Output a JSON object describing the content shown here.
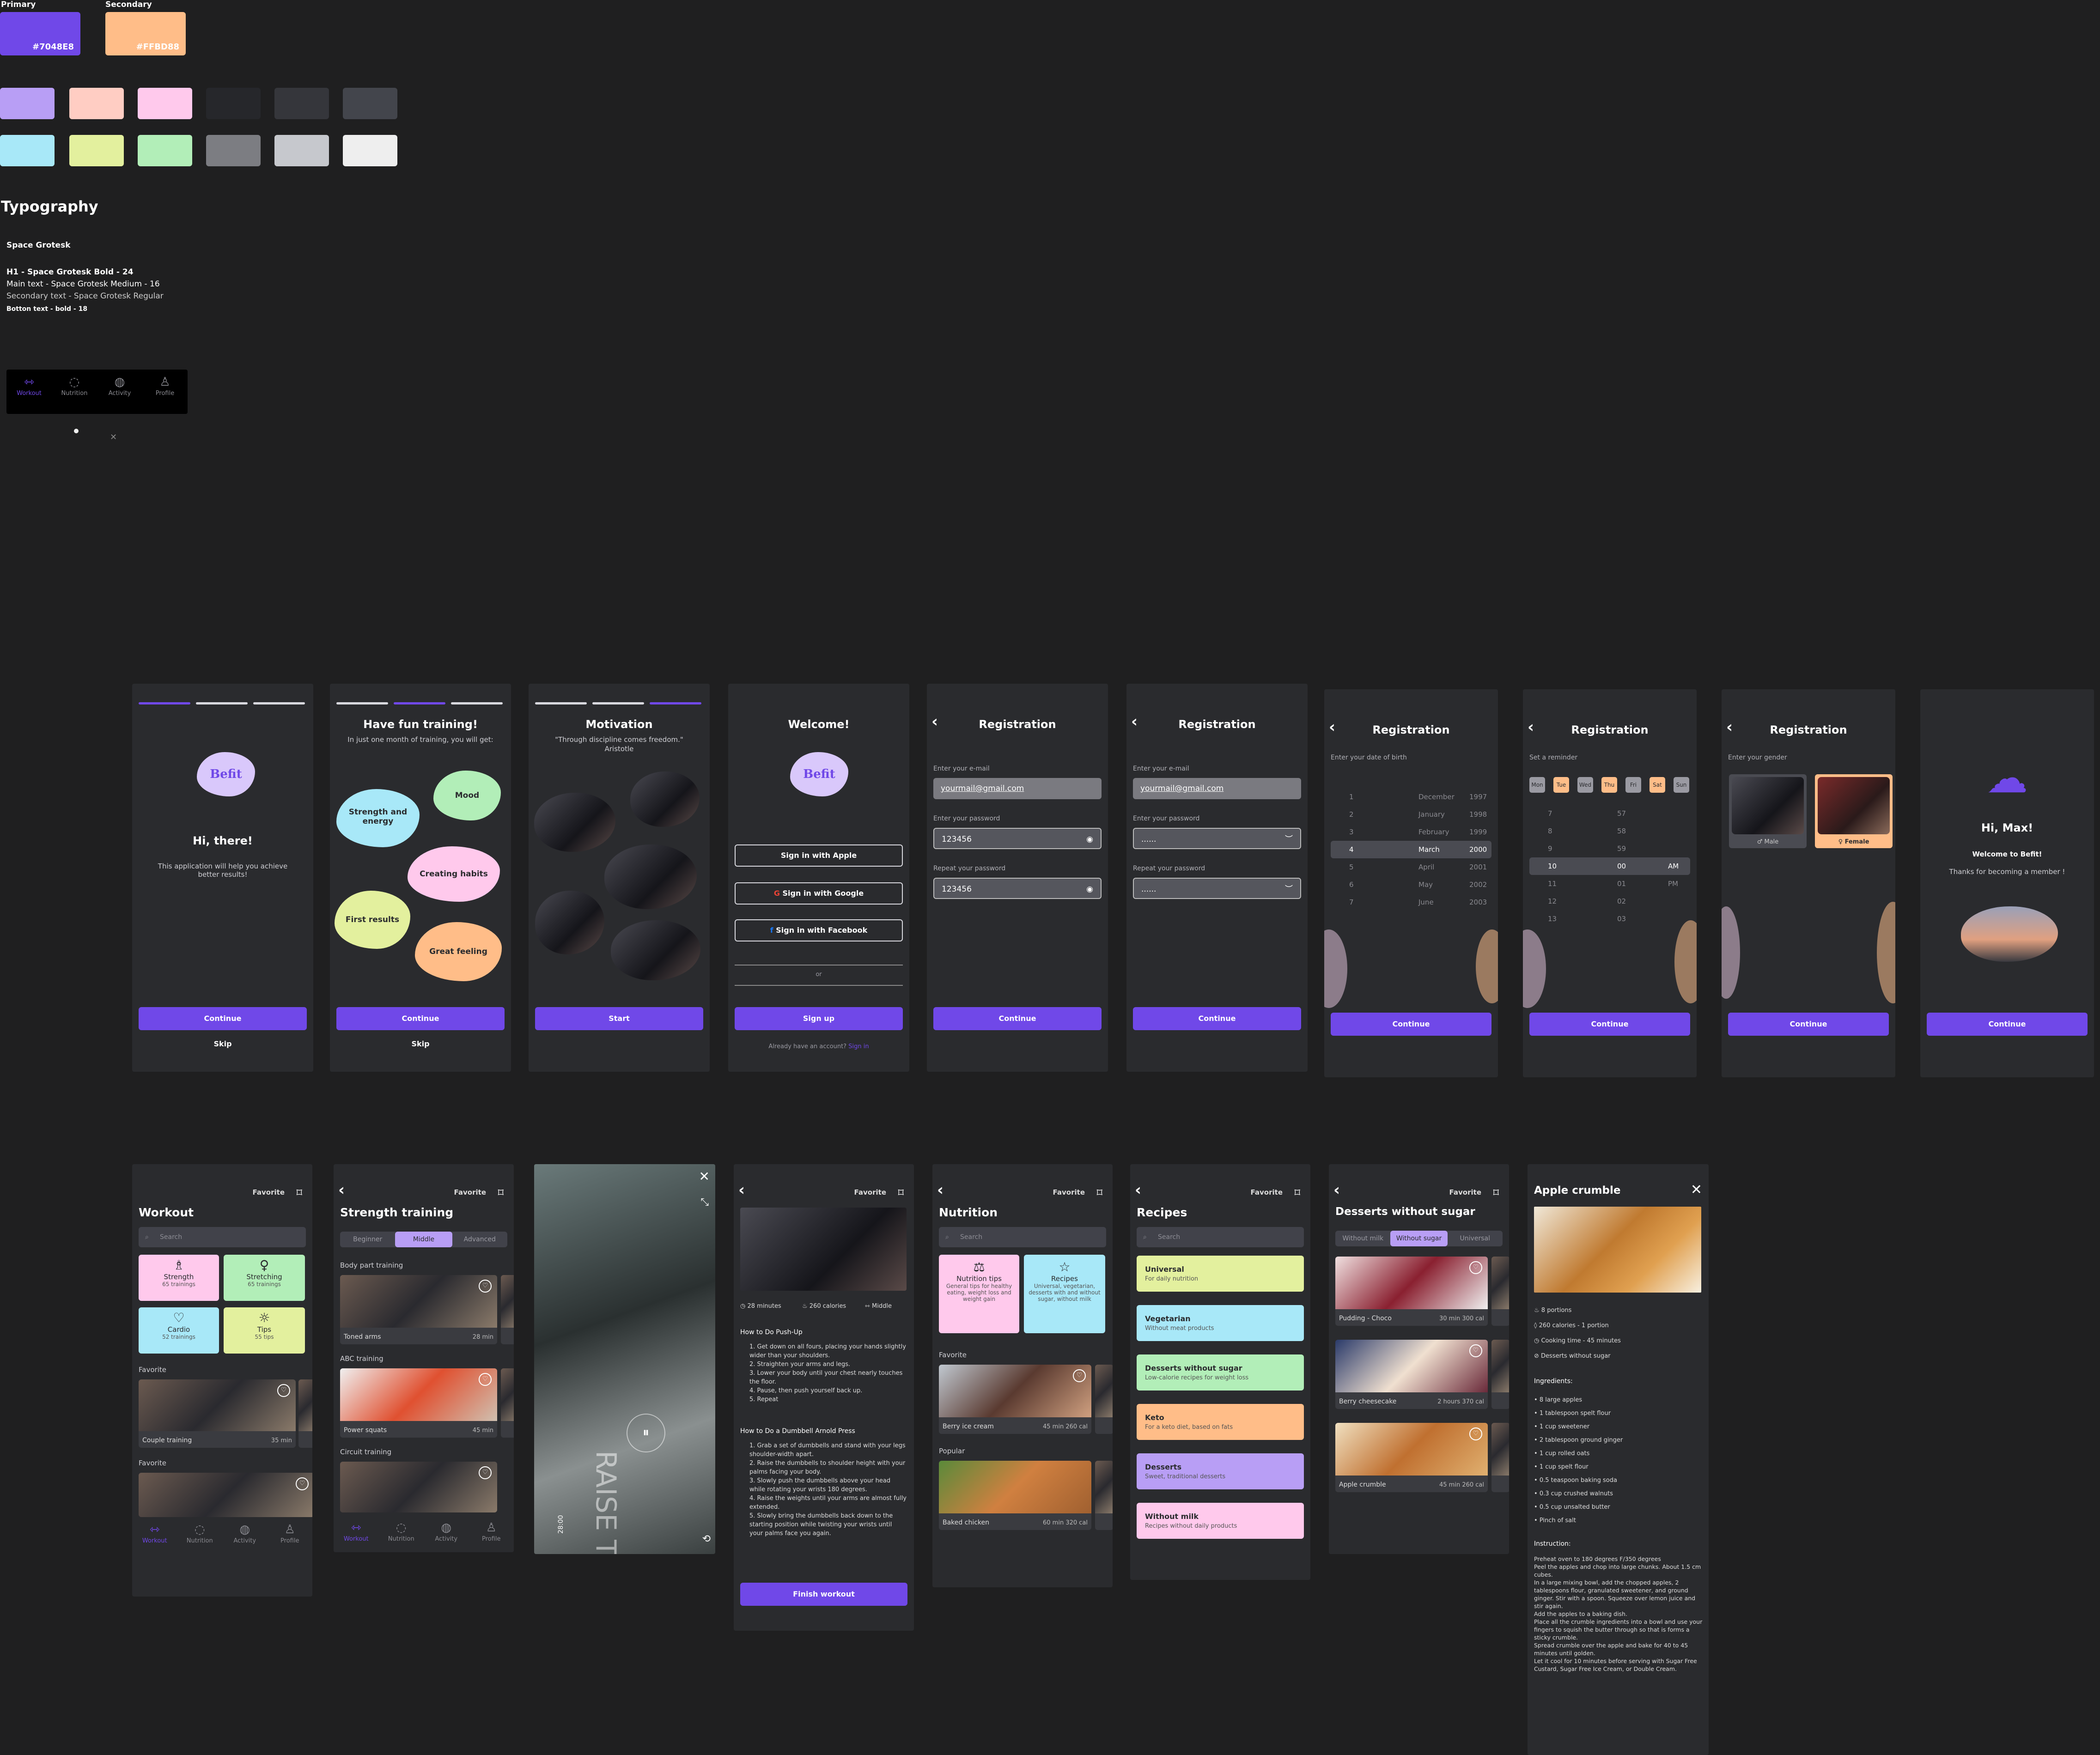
{
  "palette": {
    "primary_label": "Primary",
    "primary_hex": "#7048E8",
    "primary": "#7048e8",
    "secondary_label": "Secondary",
    "secondary_hex": "#FFBD88",
    "secondary": "#ffbd88",
    "row1": [
      "#b89ef5",
      "#ffcdc3",
      "#ffc9ec",
      "#26272b",
      "#35363b",
      "#43454c"
    ],
    "row2": [
      "#a8e8f8",
      "#e3f09e",
      "#b2eeb8",
      "#7c7d82",
      "#c6c8cd",
      "#eeeeee"
    ]
  },
  "typography": {
    "heading": "Typography",
    "font": "Space Grotesk",
    "h1": "H1 - Space Grotesk Bold - 24",
    "main": "Main text - Space Grotesk Medium - 16",
    "secondary": "Secondary text - Space Grotesk Regular",
    "button": "Botton text - bold - 18"
  },
  "navbar": {
    "items": [
      "Workout",
      "Nutrition",
      "Activity",
      "Profile"
    ]
  },
  "onboarding": {
    "s1": {
      "logo": "Befit",
      "title": "Hi, there!",
      "text": "This application will help you achieve better results!",
      "button": "Continue",
      "skip": "Skip"
    },
    "s2": {
      "title": "Have fun training!",
      "subtitle": "In just one month of training, you will get:",
      "blobs": [
        "Mood",
        "Strength and energy",
        "Creating habits",
        "First results",
        "Great feeling"
      ],
      "button": "Continue",
      "skip": "Skip"
    },
    "s3": {
      "title": "Motivation",
      "quote": "\"Through discipline comes freedom.\"",
      "author": "Aristotle",
      "button": "Start"
    },
    "s4": {
      "title": "Welcome!",
      "logo": "Befit",
      "apple": "Sign in with Apple",
      "google": "Sign in with Google",
      "facebook": "Sign in with Facebook",
      "or": "or",
      "signup": "Sign up",
      "have": "Already have an account?",
      "signin": "Sign in"
    }
  },
  "registration": {
    "title": "Registration",
    "email_label": "Enter your e-mail",
    "email": "yourmail@gmail.com",
    "password_label": "Enter your password",
    "password": "123456",
    "repeat_label": "Repeat your password",
    "repeat": "123456",
    "hidden": "......",
    "button": "Continue",
    "dob_label": "Enter your date of birth",
    "dob_rows": [
      [
        "1",
        "December",
        "1997"
      ],
      [
        "2",
        "January",
        "1998"
      ],
      [
        "3",
        "February",
        "1999"
      ],
      [
        "4",
        "March",
        "2000"
      ],
      [
        "5",
        "April",
        "2001"
      ],
      [
        "6",
        "May",
        "2002"
      ],
      [
        "7",
        "June",
        "2003"
      ]
    ],
    "reminder_label": "Set a reminder",
    "days": [
      "Mon",
      "Tue",
      "Wed",
      "Thu",
      "Fri",
      "Sat",
      "Sun"
    ],
    "time_rows": [
      [
        "7",
        "57",
        ""
      ],
      [
        "8",
        "58",
        ""
      ],
      [
        "9",
        "59",
        ""
      ],
      [
        "10",
        "00",
        "AM"
      ],
      [
        "11",
        "01",
        "PM"
      ],
      [
        "12",
        "02",
        ""
      ],
      [
        "13",
        "03",
        ""
      ]
    ],
    "gender_label": "Enter your gender",
    "male": "Male",
    "female": "Female",
    "done_title": "Hi, Max!",
    "done_welcome": "Welcome to Befit!",
    "done_thanks": "Thanks for becoming a member !"
  },
  "workout": {
    "title": "Workout",
    "favorite": "Favorite",
    "search": "Search",
    "tiles": [
      {
        "name": "Strength",
        "sub": "65 trainings"
      },
      {
        "name": "Stretching",
        "sub": "65 trainings"
      },
      {
        "name": "Cardio",
        "sub": "52 trainings"
      },
      {
        "name": "Tips",
        "sub": "55 tips"
      }
    ],
    "fav_label": "Favorite",
    "fav_card": "Couple training",
    "fav_time": "35 min",
    "fav_label2": "Favorite"
  },
  "strength": {
    "title": "Strength training",
    "favorite": "Favorite",
    "tabs": [
      "Beginner",
      "Middle",
      "Advanced"
    ],
    "sections": [
      {
        "label": "Body part training",
        "card": "Toned arms",
        "time": "28 min"
      },
      {
        "label": "ABC training",
        "card": "Power squats",
        "time": "45 min"
      },
      {
        "label": "Circuit training",
        "card": "",
        "time": ""
      }
    ]
  },
  "video": {
    "time": "28:00",
    "overlay": "RAISE THE BAR"
  },
  "exercise": {
    "favorite": "Favorite",
    "minutes": "28 minutes",
    "calories": "260 calories",
    "level": "Middle",
    "h1": "How to Do Push-Up",
    "steps1": [
      "1. Get down on all fours, placing your hands slightly wider than your shoulders.",
      "2. Straighten your arms and legs.",
      "3. Lower your body until your chest nearly touches the floor.",
      "4. Pause, then push yourself back up.",
      "5. Repeat"
    ],
    "h2": "How to Do a Dumbbell Arnold Press",
    "steps2": [
      "1. Grab a set of dumbbells and stand with your legs shoulder-width apart.",
      "2. Raise the dumbbells to shoulder height with your palms facing your body.",
      "3. Slowly push the dumbbells above your head while rotating your wrists 180 degrees.",
      "4. Raise the weights until your arms are almost fully extended.",
      "5. Slowly bring the dumbbells back down to the starting position while twisting your wrists until your palms face you again."
    ],
    "button": "Finish workout"
  },
  "nutrition": {
    "title": "Nutrition",
    "favorite": "Favorite",
    "search": "Search",
    "tip_title": "Nutrition tips",
    "tip_text": "General tips for healthy eating, weight loss and weight gain",
    "rec_title": "Recipes",
    "rec_text": "Universal, vegetarian, desserts with and without sugar, without milk",
    "fav_label": "Favorite",
    "fav_card": "Berry ice cream",
    "fav_meta": "45 min   260 cal",
    "pop_label": "Popular",
    "pop_card": "Baked chicken",
    "pop_meta": "60 min   320 cal"
  },
  "recipes": {
    "title": "Recipes",
    "favorite": "Favorite",
    "search": "Search",
    "cats": [
      {
        "name": "Universal",
        "sub": "For daily nutrition",
        "color": "#e3f09e"
      },
      {
        "name": "Vegetarian",
        "sub": "Without meat products",
        "color": "#a8e8f8"
      },
      {
        "name": "Desserts without sugar",
        "sub": "Low-calorie recipes for weight loss",
        "color": "#b2eeb8"
      },
      {
        "name": "Keto",
        "sub": "For a keto diet, based on fats",
        "color": "#ffbd88"
      },
      {
        "name": "Desserts",
        "sub": "Sweet, traditional desserts",
        "color": "#b89ef5"
      },
      {
        "name": "Without milk",
        "sub": "Recipes without daily products",
        "color": "#ffc9ec"
      }
    ]
  },
  "desserts": {
    "title": "Desserts without sugar",
    "favorite": "Favorite",
    "tabs": [
      "Without milk",
      "Without sugar",
      "Universal"
    ],
    "cards": [
      {
        "name": "Pudding - Choco",
        "meta": "30 min   300 cal"
      },
      {
        "name": "Berry cheesecake",
        "meta": "2 hours   370 cal"
      },
      {
        "name": "Apple crumble",
        "meta": "45 min   260 cal"
      }
    ]
  },
  "crumble": {
    "title": "Apple crumble",
    "facts": [
      "8 portions",
      "260 calories - 1 portion",
      "Cooking time - 45 minutes",
      "Desserts without sugar"
    ],
    "ing_label": "Ingredients:",
    "ingredients": [
      "8 large apples",
      "1 tablespoon spelt flour",
      "1 cup sweetener",
      "2 tablespoon ground ginger",
      "1 cup rolled oats",
      "1 cup spelt flour",
      "0.5 teaspoon baking soda",
      "0.3 cup crushed walnuts",
      "0.5 cup unsalted butter",
      "Pinch of salt"
    ],
    "ins_label": "Instruction:",
    "instructions": [
      "Preheat oven to 180 degrees F/350 degrees",
      "Peel the apples and chop into large chunks. About 1.5 cm cubes.",
      "In a large mixing bowl, add the chopped apples, 2 tablespoons flour, granulated sweetener, and ground ginger. Stir with a spoon. Squeeze over lemon juice and stir again.",
      "Add the apples to a baking dish.",
      "Place all the crumble ingredients into a bowl and use your fingers to squish the butter through so that is forms a sticky crumble.",
      "Spread crumble over the apple and bake for 40 to 45 minutes until golden.",
      "Let it cool for 10 minutes before serving with Sugar Free Custard, Sugar Free Ice Cream, or Double Cream."
    ]
  }
}
